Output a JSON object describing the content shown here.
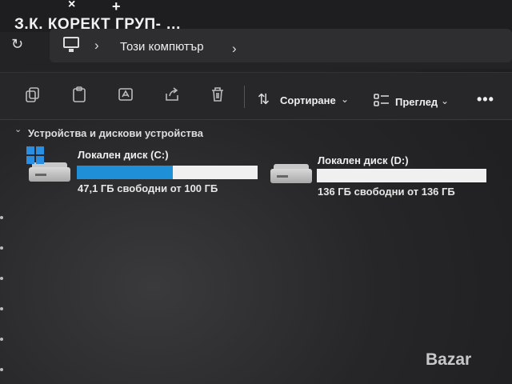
{
  "tab": {
    "title": "З.К. КОРЕКТ ГРУП- …",
    "close_glyph": "×",
    "new_glyph": "+"
  },
  "nav": {
    "breadcrumb": "Този компютър"
  },
  "toolbar": {
    "sort_label": "Сортиране",
    "view_label": "Преглед",
    "more_glyph": "•••"
  },
  "section": {
    "label": "Устройства и дискови устройства"
  },
  "drives": [
    {
      "name": "Локален диск (C:)",
      "free_text": "47,1 ГБ свободни от 100 ГБ",
      "used_fraction": 0.529,
      "system": true,
      "bar_color": "#1f8fd8"
    },
    {
      "name": "Локален диск (D:)",
      "free_text": "136 ГБ свободни от 136 ГБ",
      "used_fraction": 0.0,
      "system": false,
      "bar_color": "#1f8fd8"
    }
  ],
  "watermark": "Bazar"
}
